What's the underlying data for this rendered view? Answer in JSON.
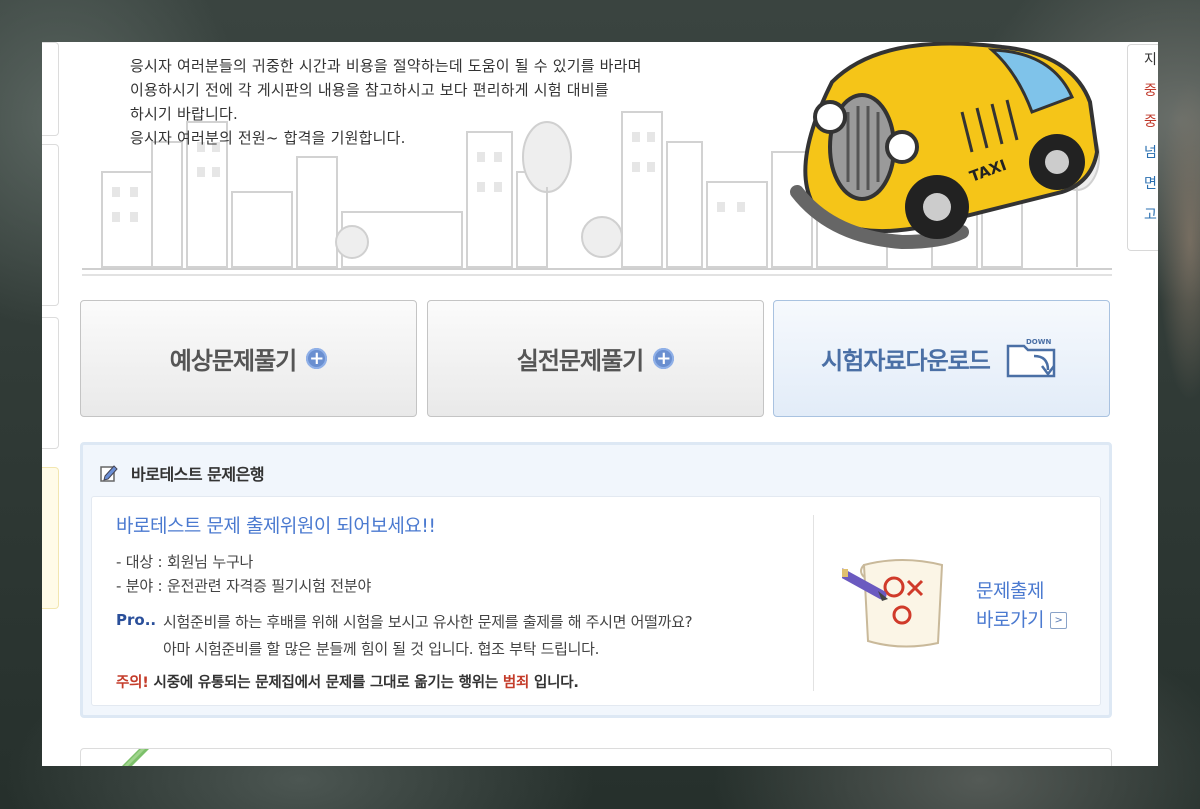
{
  "hero": {
    "lines": [
      "응시자 여러분들의 귀중한 시간과 비용을 절약하는데 도움이 될 수 있기를 바라며",
      "이용하시기  전에 각 게시판의 내용을 참고하시고 보다 편리하게 시험 대비를",
      "하시기 바랍니다.",
      "응시자 여러분의 전원~ 합격을 기원합니다."
    ],
    "taxi_sign": "TAXI"
  },
  "right_sidebar": [
    {
      "text": "지",
      "color": "#333333"
    },
    {
      "text": "중",
      "color": "#c0392b"
    },
    {
      "text": "중",
      "color": "#c0392b"
    },
    {
      "text": "넘",
      "color": "#2a6fb0"
    },
    {
      "text": "면",
      "color": "#2a6fb0"
    },
    {
      "text": "고",
      "color": "#2a6fb0"
    }
  ],
  "buttons": {
    "predict": "예상문제풀기",
    "practice": "실전문제풀기",
    "download": "시험자료다운로드",
    "download_icon_text": "DOWN"
  },
  "bank": {
    "title": "바로테스트 문제은행",
    "headline": "바로테스트 문제 출제위원이 되어보세요!!",
    "target": "- 대상 : 회원님 누구나",
    "field": "- 분야 : 운전관련 자격증 필기시험 전분야",
    "pro_label": "Pro..",
    "pro_line1": "시험준비를 하는 후배를 위해 시험을 보시고 유사한 문제를 출제를 해 주시면 어떨까요?",
    "pro_line2": "아마 시험준비를 할 많은 분들께 힘이 될 것 입니다. 협조 부탁 드립니다.",
    "warn_label": "주의!",
    "warn_text": " 시중에 유통되는 문제집에서 문제를 그대로 옮기는 행위는 ",
    "warn_crime": "범죄",
    "warn_end": " 입니다.",
    "go_line1": "문제출제",
    "go_line2": "바로가기",
    "go_arrow": ">"
  },
  "colors": {
    "accent_blue": "#4b7ad0",
    "warn_red": "#c43c2a",
    "taxi_yellow": "#f5c518"
  }
}
